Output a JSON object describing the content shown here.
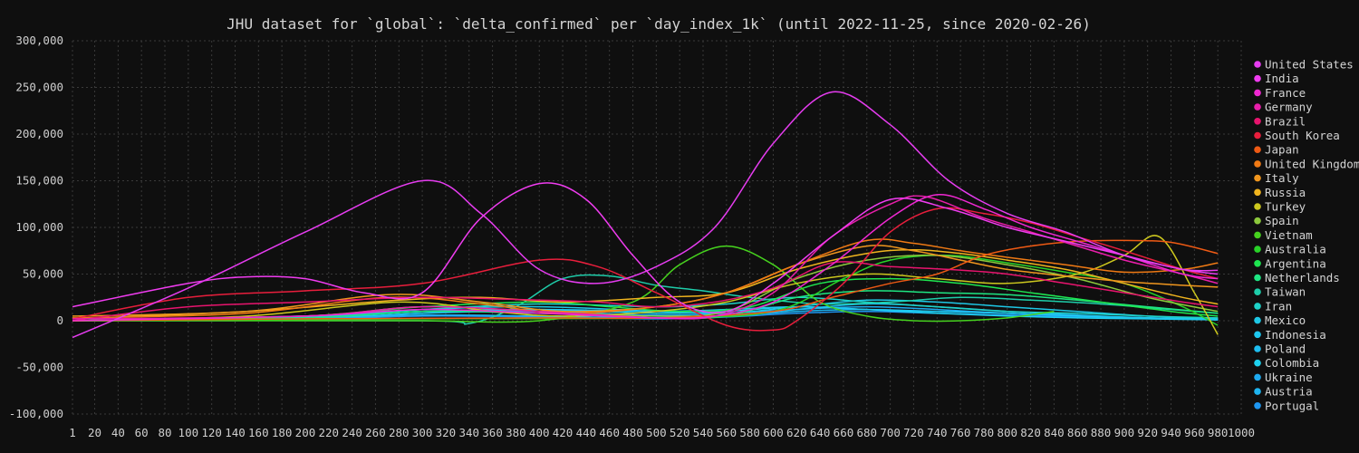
{
  "chart_data": {
    "type": "line",
    "title": "JHU dataset for `global`: `delta_confirmed` per `day_index_1k` (until 2022-11-25, since 2020-02-26)",
    "xlabel": "",
    "ylabel": "",
    "xlim": [
      1,
      1000
    ],
    "ylim": [
      -100000,
      300000
    ],
    "grid": true,
    "legend_position": "right",
    "x_ticks": [
      1,
      20,
      40,
      60,
      80,
      100,
      120,
      140,
      160,
      180,
      200,
      220,
      240,
      260,
      280,
      300,
      320,
      340,
      360,
      380,
      400,
      420,
      440,
      460,
      480,
      500,
      520,
      540,
      560,
      580,
      600,
      620,
      640,
      660,
      680,
      700,
      720,
      740,
      760,
      780,
      800,
      820,
      840,
      860,
      880,
      900,
      920,
      940,
      960,
      980,
      1000
    ],
    "x_tick_labels": [
      "1",
      "20",
      "40",
      "60",
      "80",
      "100",
      "120",
      "140",
      "160",
      "180",
      "200",
      "220",
      "240",
      "260",
      "280",
      "300",
      "320",
      "340",
      "360",
      "380",
      "400",
      "420",
      "440",
      "460",
      "480",
      "500",
      "520",
      "540",
      "560",
      "580",
      "600",
      "620",
      "640",
      "660",
      "680",
      "700",
      "720",
      "740",
      "760",
      "780",
      "800",
      "820",
      "840",
      "860",
      "880",
      "900",
      "920",
      "940",
      "960",
      "980",
      "1000"
    ],
    "y_ticks": [
      -100000,
      -50000,
      0,
      50000,
      100000,
      150000,
      200000,
      250000,
      300000
    ],
    "y_tick_labels": [
      "-100,000",
      "-50,000",
      "0",
      "50,000",
      "100,000",
      "150,000",
      "200,000",
      "250,000",
      "300,000"
    ],
    "series": [
      {
        "name": "United States",
        "color": "#e63cf0",
        "x": [
          1,
          100,
          200,
          300,
          350,
          400,
          450,
          500,
          550,
          600,
          650,
          700,
          750,
          800,
          850,
          900,
          950,
          980
        ],
        "y": [
          -18000,
          35000,
          95000,
          150000,
          115000,
          55000,
          40000,
          58000,
          100000,
          190000,
          245000,
          210000,
          150000,
          115000,
          95000,
          70000,
          55000,
          50000
        ]
      },
      {
        "name": "India",
        "color": "#f03cf0",
        "x": [
          1,
          100,
          150,
          200,
          250,
          300,
          350,
          400,
          440,
          480,
          520,
          560,
          600,
          650,
          700,
          750,
          800,
          850,
          900,
          950,
          980
        ],
        "y": [
          15000,
          40000,
          47000,
          45000,
          30000,
          30000,
          110000,
          147000,
          130000,
          70000,
          20000,
          10000,
          40000,
          90000,
          130000,
          120000,
          100000,
          85000,
          70000,
          55000,
          54000
        ]
      },
      {
        "name": "France",
        "color": "#f028d2",
        "x": [
          1,
          200,
          300,
          400,
          500,
          550,
          600,
          650,
          700,
          740,
          780,
          820,
          860,
          900,
          950,
          980
        ],
        "y": [
          0,
          5000,
          12000,
          8000,
          3000,
          5000,
          20000,
          60000,
          110000,
          135000,
          120000,
          100000,
          85000,
          70000,
          50000,
          45000
        ]
      },
      {
        "name": "Germany",
        "color": "#e81eaa",
        "x": [
          1,
          200,
          300,
          400,
          500,
          550,
          600,
          650,
          700,
          730,
          780,
          820,
          860,
          900,
          950,
          980
        ],
        "y": [
          2000,
          5000,
          15000,
          10000,
          3000,
          5000,
          30000,
          90000,
          125000,
          133000,
          110000,
          95000,
          80000,
          65000,
          50000,
          40000
        ]
      },
      {
        "name": "Brazil",
        "color": "#e8146e",
        "x": [
          1,
          100,
          200,
          300,
          400,
          450,
          500,
          550,
          600,
          650,
          700,
          750,
          800,
          850,
          900,
          950,
          980
        ],
        "y": [
          0,
          15000,
          20000,
          25000,
          22000,
          20000,
          15000,
          20000,
          35000,
          62000,
          58000,
          55000,
          50000,
          40000,
          30000,
          20000,
          15000
        ]
      },
      {
        "name": "South Korea",
        "color": "#e81e3c",
        "x": [
          1,
          100,
          200,
          300,
          400,
          450,
          500,
          560,
          600,
          620,
          660,
          700,
          740,
          780,
          820,
          860,
          900,
          950,
          980
        ],
        "y": [
          2000,
          25000,
          32000,
          40000,
          65000,
          58000,
          30000,
          -5000,
          -10000,
          0,
          40000,
          95000,
          120000,
          115000,
          105000,
          90000,
          75000,
          55000,
          45000
        ]
      },
      {
        "name": "Japan",
        "color": "#ee5a14",
        "x": [
          1,
          200,
          400,
          500,
          600,
          650,
          700,
          740,
          780,
          820,
          860,
          900,
          940,
          980
        ],
        "y": [
          0,
          2000,
          3000,
          3000,
          10000,
          25000,
          40000,
          50000,
          70000,
          80000,
          85000,
          86000,
          84000,
          72000
        ]
      },
      {
        "name": "United Kingdom",
        "color": "#f07a14",
        "x": [
          1,
          150,
          270,
          350,
          420,
          500,
          560,
          620,
          680,
          720,
          760,
          800,
          850,
          900,
          950,
          980
        ],
        "y": [
          3000,
          8000,
          25000,
          18000,
          8000,
          15000,
          30000,
          60000,
          86000,
          83000,
          75000,
          68000,
          60000,
          52000,
          55000,
          62000
        ]
      },
      {
        "name": "Italy",
        "color": "#f0961e",
        "x": [
          1,
          150,
          270,
          350,
          420,
          500,
          560,
          620,
          680,
          720,
          760,
          800,
          850,
          900,
          950,
          980
        ],
        "y": [
          5000,
          10000,
          28000,
          20000,
          10000,
          15000,
          30000,
          60000,
          80000,
          75000,
          65000,
          55000,
          48000,
          42000,
          38000,
          36000
        ]
      },
      {
        "name": "Russia",
        "color": "#f0b41e",
        "x": [
          1,
          150,
          280,
          350,
          420,
          500,
          560,
          620,
          680,
          720,
          760,
          800,
          850,
          900,
          950,
          980
        ],
        "y": [
          2000,
          10000,
          22000,
          25000,
          20000,
          25000,
          30000,
          55000,
          72000,
          76000,
          72000,
          65000,
          55000,
          40000,
          25000,
          18000
        ]
      },
      {
        "name": "Turkey",
        "color": "#cdc81e",
        "x": [
          1,
          150,
          280,
          360,
          420,
          500,
          560,
          620,
          680,
          740,
          800,
          860,
          900,
          930,
          960,
          980
        ],
        "y": [
          0,
          5000,
          20000,
          10000,
          5000,
          10000,
          20000,
          40000,
          50000,
          45000,
          40000,
          50000,
          70000,
          90000,
          30000,
          -15000
        ]
      },
      {
        "name": "Spain",
        "color": "#8cc83c",
        "x": [
          1,
          200,
          300,
          400,
          500,
          560,
          620,
          680,
          740,
          800,
          860,
          920,
          980
        ],
        "y": [
          0,
          5000,
          15000,
          10000,
          5000,
          10000,
          45000,
          65000,
          70000,
          60000,
          45000,
          25000,
          10000
        ]
      },
      {
        "name": "Vietnam",
        "color": "#46d21e",
        "x": [
          1,
          200,
          300,
          400,
          480,
          520,
          560,
          600,
          640,
          680,
          720,
          760,
          800,
          840
        ],
        "y": [
          0,
          0,
          0,
          0,
          20000,
          60000,
          80000,
          60000,
          20000,
          5000,
          0,
          0,
          3000,
          10000
        ]
      },
      {
        "name": "Australia",
        "color": "#28d228",
        "x": [
          1,
          300,
          500,
          600,
          660,
          700,
          750,
          800,
          850,
          900,
          950,
          980
        ],
        "y": [
          0,
          2000,
          3000,
          10000,
          45000,
          65000,
          70000,
          62000,
          52000,
          40000,
          15000,
          -5000
        ]
      },
      {
        "name": "Argentina",
        "color": "#1ee650",
        "x": [
          1,
          200,
          300,
          400,
          460,
          520,
          580,
          640,
          700,
          760,
          820,
          880,
          940,
          980
        ],
        "y": [
          0,
          5000,
          15000,
          20000,
          15000,
          10000,
          15000,
          40000,
          45000,
          40000,
          30000,
          20000,
          10000,
          5000
        ]
      },
      {
        "name": "Netherlands",
        "color": "#1ee682",
        "x": [
          1,
          200,
          300,
          400,
          500,
          560,
          620,
          680,
          740,
          800,
          860,
          920,
          980
        ],
        "y": [
          0,
          3000,
          10000,
          8000,
          3000,
          5000,
          25000,
          32000,
          30000,
          28000,
          22000,
          15000,
          8000
        ]
      },
      {
        "name": "Taiwan",
        "color": "#1ecdaa",
        "x": [
          1,
          300,
          340,
          380,
          420,
          460,
          500,
          540,
          580,
          640,
          700,
          760,
          820,
          880,
          940,
          980
        ],
        "y": [
          0,
          0,
          -3000,
          15000,
          45000,
          48000,
          38000,
          32000,
          25000,
          18000,
          20000,
          25000,
          22000,
          18000,
          12000,
          8000
        ]
      },
      {
        "name": "Iran",
        "color": "#1ed2c8",
        "x": [
          1,
          200,
          300,
          400,
          500,
          560,
          620,
          680,
          740,
          800,
          860,
          920,
          980
        ],
        "y": [
          0,
          5000,
          12000,
          18000,
          15000,
          18000,
          25000,
          20000,
          15000,
          10000,
          8000,
          5000,
          3000
        ]
      },
      {
        "name": "Mexico",
        "color": "#1ec8e6",
        "x": [
          1,
          200,
          300,
          400,
          500,
          560,
          620,
          680,
          740,
          800,
          860,
          920,
          980
        ],
        "y": [
          0,
          5000,
          12000,
          15000,
          10000,
          8000,
          15000,
          22000,
          20000,
          15000,
          10000,
          5000,
          2000
        ]
      },
      {
        "name": "Indonesia",
        "color": "#1ec8f0",
        "x": [
          1,
          200,
          300,
          400,
          500,
          560,
          620,
          680,
          740,
          800,
          860,
          920,
          980
        ],
        "y": [
          0,
          3000,
          8000,
          12000,
          10000,
          12000,
          15000,
          12000,
          10000,
          8000,
          5000,
          3000,
          1000
        ]
      },
      {
        "name": "Poland",
        "color": "#1ebef0",
        "x": [
          1,
          200,
          300,
          400,
          500,
          560,
          620,
          680,
          740,
          800,
          860,
          920,
          980
        ],
        "y": [
          0,
          3000,
          10000,
          8000,
          5000,
          5000,
          12000,
          18000,
          15000,
          10000,
          6000,
          3000,
          1000
        ]
      },
      {
        "name": "Colombia",
        "color": "#1ed2f0",
        "x": [
          1,
          200,
          300,
          400,
          500,
          560,
          620,
          680,
          740,
          800,
          860,
          920,
          980
        ],
        "y": [
          0,
          4000,
          10000,
          12000,
          8000,
          10000,
          15000,
          12000,
          8000,
          5000,
          3000,
          2000,
          1000
        ]
      },
      {
        "name": "Ukraine",
        "color": "#1eaaf0",
        "x": [
          1,
          200,
          300,
          400,
          500,
          560,
          620,
          680,
          740,
          800,
          860,
          920,
          980
        ],
        "y": [
          0,
          2000,
          8000,
          10000,
          6000,
          8000,
          12000,
          15000,
          12000,
          8000,
          5000,
          3000,
          1000
        ]
      },
      {
        "name": "Austria",
        "color": "#1eb4f0",
        "x": [
          1,
          200,
          300,
          400,
          500,
          560,
          620,
          680,
          740,
          800,
          860,
          920,
          980
        ],
        "y": [
          0,
          2000,
          6000,
          5000,
          3000,
          5000,
          10000,
          12000,
          10000,
          8000,
          5000,
          3000,
          2000
        ]
      },
      {
        "name": "Portugal",
        "color": "#1e96f0",
        "x": [
          1,
          200,
          300,
          400,
          500,
          560,
          620,
          680,
          740,
          800,
          860,
          920,
          980
        ],
        "y": [
          0,
          1500,
          5000,
          4000,
          2000,
          4000,
          8000,
          10000,
          8000,
          6000,
          4000,
          2500,
          1500
        ]
      }
    ]
  }
}
